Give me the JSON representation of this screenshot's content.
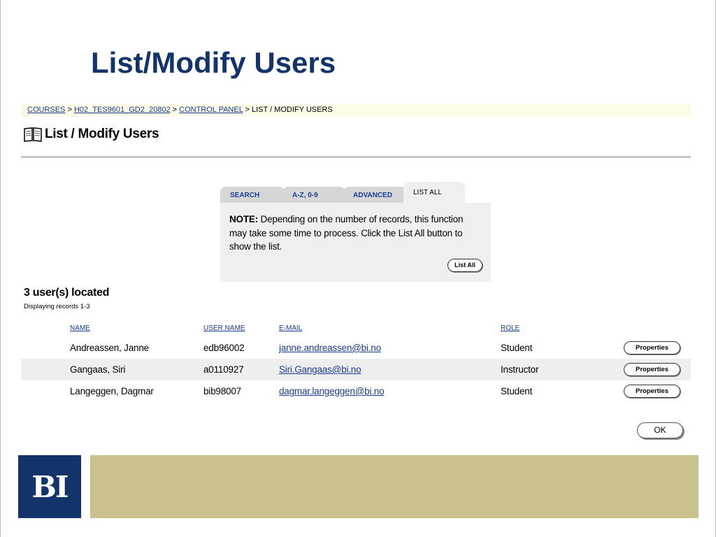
{
  "slide": {
    "title": "List/Modify Users"
  },
  "breadcrumb": {
    "items": [
      {
        "label": "COURSES"
      },
      {
        "label": "H02_TES9601_GD2_20802"
      },
      {
        "label": "CONTROL PANEL"
      }
    ],
    "separator": ">",
    "current": "LIST / MODIFY USERS"
  },
  "page": {
    "heading": "List / Modify Users",
    "heading_icon": "book-icon"
  },
  "tabs": [
    {
      "label": "SEARCH",
      "active": false
    },
    {
      "label": "A-Z, 0-9",
      "active": false
    },
    {
      "label": "ADVANCED",
      "active": false
    },
    {
      "label": "LIST ALL",
      "active": true
    }
  ],
  "note": {
    "prefix": "NOTE:",
    "body": " Depending on the number of records, this function may take some time to process. Click the List All button to show the list.",
    "button_label": "List All"
  },
  "results": {
    "count_text": "3 user(s) located",
    "displaying_text": "Displaying records 1-3"
  },
  "table": {
    "headers": {
      "name": "NAME",
      "username": "USER NAME",
      "email": "E-MAIL",
      "role": "ROLE"
    },
    "rows": [
      {
        "name": "Andreassen, Janne",
        "username": "edb96002",
        "email": "janne.andreassen@bi.no",
        "role": "Student",
        "action": "Properties"
      },
      {
        "name": "Gangaas, Siri",
        "username": "a0110927",
        "email": "Siri.Gangaas@bi.no",
        "role": "Instructor",
        "action": "Properties"
      },
      {
        "name": "Langeggen, Dagmar",
        "username": "bib98007",
        "email": "dagmar.langeggen@bi.no",
        "role": "Student",
        "action": "Properties"
      }
    ]
  },
  "ok_button": {
    "label": "OK"
  },
  "footer": {
    "logo_text": "BI"
  },
  "colors": {
    "title_blue": "#12346b",
    "link_blue": "#1a3c93",
    "footer_band": "#c9c18e",
    "breadcrumb_bg": "#fbfbe6"
  }
}
